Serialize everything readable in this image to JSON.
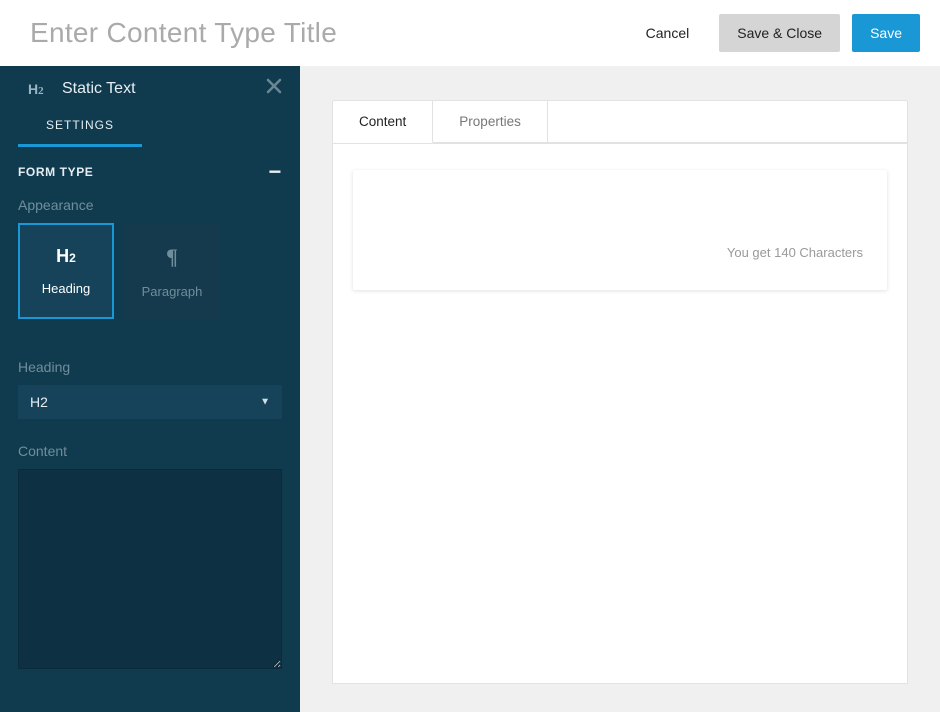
{
  "topbar": {
    "title_placeholder": "Enter Content Type Title",
    "cancel_label": "Cancel",
    "save_close_label": "Save & Close",
    "save_label": "Save"
  },
  "sidebar": {
    "icon_name": "heading-h2-icon",
    "title": "Static Text",
    "tabs": [
      {
        "label": "SETTINGS",
        "active": true
      }
    ],
    "section_formtype": {
      "title": "FORM TYPE",
      "appearance_label": "Appearance",
      "options": [
        {
          "label": "Heading",
          "icon": "heading-h2-icon",
          "selected": true
        },
        {
          "label": "Paragraph",
          "icon": "paragraph-icon",
          "selected": false
        }
      ],
      "heading_label": "Heading",
      "heading_select_value": "H2",
      "content_label": "Content",
      "content_value": ""
    }
  },
  "content_area": {
    "tabs": [
      {
        "label": "Content",
        "active": true
      },
      {
        "label": "Properties",
        "active": false
      }
    ],
    "card": {
      "char_hint": "You get 140 Characters"
    }
  }
}
